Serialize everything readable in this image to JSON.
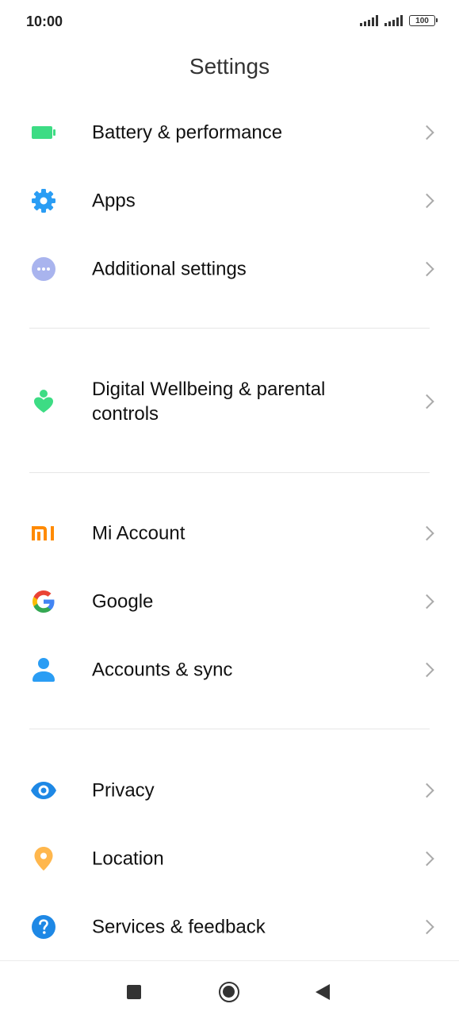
{
  "status_bar": {
    "time": "10:00",
    "battery_level": "100"
  },
  "page": {
    "title": "Settings"
  },
  "sections": [
    {
      "items": [
        {
          "label": "Battery & performance",
          "icon": "battery-icon"
        },
        {
          "label": "Apps",
          "icon": "gear-icon"
        },
        {
          "label": "Additional settings",
          "icon": "more-dots-icon"
        }
      ]
    },
    {
      "items": [
        {
          "label": "Digital Wellbeing & parental controls",
          "icon": "wellbeing-icon"
        }
      ]
    },
    {
      "items": [
        {
          "label": "Mi Account",
          "icon": "mi-logo-icon"
        },
        {
          "label": "Google",
          "icon": "google-icon"
        },
        {
          "label": "Accounts & sync",
          "icon": "person-icon"
        }
      ]
    },
    {
      "items": [
        {
          "label": "Privacy",
          "icon": "eye-icon"
        },
        {
          "label": "Location",
          "icon": "location-pin-icon"
        },
        {
          "label": "Services & feedback",
          "icon": "help-icon"
        }
      ]
    }
  ],
  "colors": {
    "battery_green": "#3ddc84",
    "apps_blue": "#2a9df4",
    "additional_lavender": "#a9b4ee",
    "wellbeing_green": "#3ddc84",
    "mi_orange": "#ff8a00",
    "account_blue": "#2a9df4",
    "privacy_blue": "#1e88e5",
    "location_yellow": "#ffb74d",
    "services_blue": "#1e88e5"
  }
}
